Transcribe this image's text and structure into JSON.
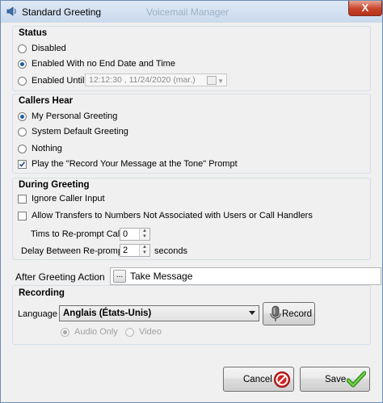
{
  "window": {
    "title": "Standard Greeting",
    "ghost_title": "Voicemail Manager",
    "close_label": "X"
  },
  "status": {
    "title": "Status",
    "options": [
      "Disabled",
      "Enabled With no End Date and Time",
      "Enabled Until:"
    ],
    "selected": 1,
    "until_value": "12:12:30 , 11/24/2020 (mar.)"
  },
  "callers_hear": {
    "title": "Callers Hear",
    "options": [
      "My Personal Greeting",
      "System Default Greeting",
      "Nothing"
    ],
    "selected": 0,
    "play_prompt_label": "Play the \"Record Your Message at the Tone\" Prompt",
    "play_prompt_checked": true
  },
  "during_greeting": {
    "title": "During Greeting",
    "ignore_input_label": "Ignore Caller Input",
    "ignore_input_checked": false,
    "allow_transfers_label": "Allow Transfers to Numbers Not Associated with Users or Call Handlers",
    "allow_transfers_checked": false,
    "reprompt_label": "Tims to Re-prompt Caller:",
    "reprompt_value": "0",
    "delay_label": "Delay Between Re-prompts:",
    "delay_value": "2",
    "delay_unit": "seconds"
  },
  "after_greeting": {
    "label": "After Greeting Action",
    "button_label": "...",
    "value": "Take Message"
  },
  "recording": {
    "title": "Recording",
    "language_label": "Language",
    "language_value": "Anglais (États-Unis)",
    "record_label": "Record",
    "audio_only_label": "Audio Only",
    "video_label": "Video",
    "media_selected": "Audio Only"
  },
  "footer": {
    "cancel_label": "Cancel",
    "save_label": "Save"
  },
  "colors": {
    "accent": "#1d5ea8",
    "close_red": "#c7432a",
    "save_green": "#4caf2a",
    "cancel_red": "#d02020"
  }
}
